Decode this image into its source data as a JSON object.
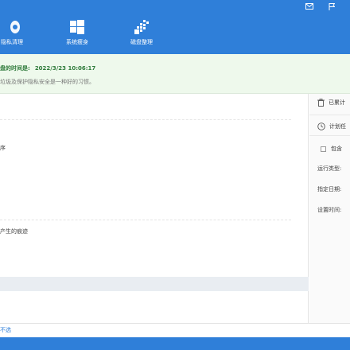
{
  "toolbar": {
    "items": [
      {
        "label": "隐私清理",
        "icon": "privacy-clean-icon"
      },
      {
        "label": "系统瘦身",
        "icon": "windows-icon"
      },
      {
        "label": "磁盘整理",
        "icon": "defrag-icon"
      }
    ],
    "system_icons": [
      "mail-icon",
      "flag-icon"
    ]
  },
  "notice": {
    "title": "盘的时间是:",
    "date": "2022/3/23 10:06:17",
    "subtitle": "垃圾及保护隐私安全是一种好的习惯。"
  },
  "main": {
    "row1": "序",
    "row2": "产生的痕迹"
  },
  "sidebar": {
    "accumulated_label": "已累计",
    "plan_label": "计划任",
    "include_label": "包含",
    "run_type_label": "运行类型:",
    "date_label": "指定日期:",
    "time_label": "设置时间:"
  },
  "footer": {
    "link": "不选"
  },
  "colors": {
    "accent": "#2f7fd9",
    "notice_bg": "#eef9ec",
    "notice_text": "#2e7a3a"
  }
}
